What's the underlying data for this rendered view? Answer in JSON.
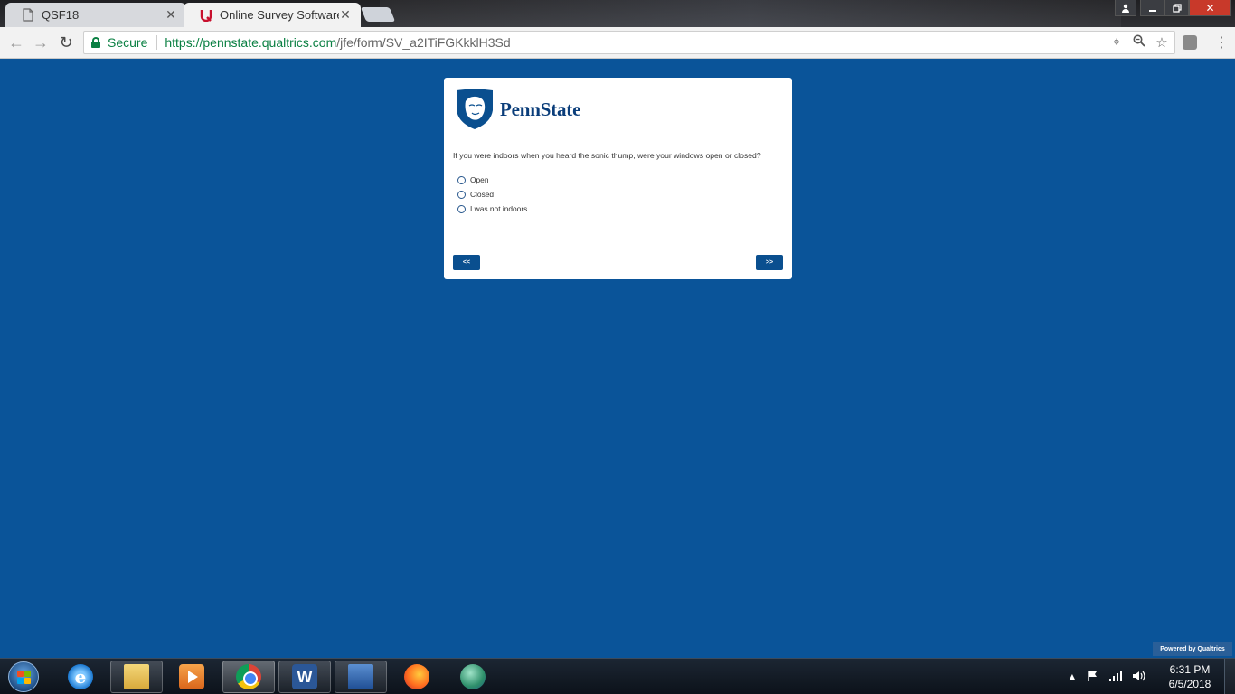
{
  "browser": {
    "tabs": [
      {
        "title": "QSF18",
        "active": false
      },
      {
        "title": "Online Survey Software | Q",
        "active": true
      }
    ],
    "address": {
      "secure_label": "Secure",
      "url_host": "https://pennstate.qualtrics.com",
      "url_path": "/jfe/form/SV_a2ITiFGKkklH3Sd"
    }
  },
  "survey": {
    "logo_text": "PennState",
    "question": "If you were indoors when you heard the sonic thump, were your windows open or closed?",
    "choices": [
      "Open",
      "Closed",
      "I was not indoors"
    ],
    "back_label": "<<",
    "next_label": ">>",
    "powered_by": "Powered by Qualtrics"
  },
  "taskbar": {
    "time": "6:31 PM",
    "date": "6/5/2018",
    "apps": [
      "internet-explorer",
      "file-explorer",
      "media-player",
      "chrome",
      "word",
      "remote-desktop",
      "firefox",
      "globe-app"
    ]
  },
  "colors": {
    "page_background": "#0a5499",
    "button": "#0a4f8f",
    "secure_green": "#0b8043"
  }
}
